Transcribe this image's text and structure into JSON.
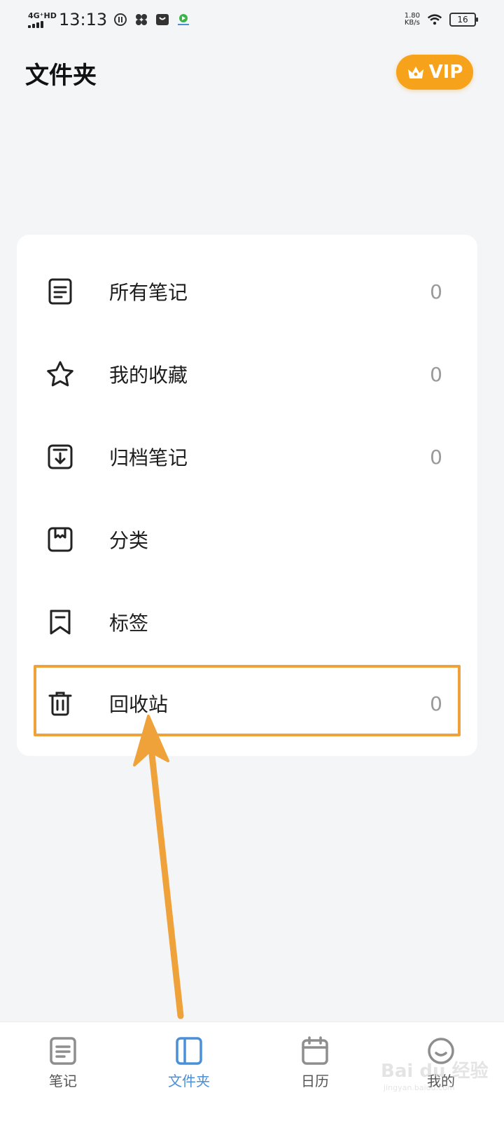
{
  "status_bar": {
    "network": "4G⁺HD",
    "time": "13:13",
    "speed_value": "1.80",
    "speed_unit": "KB/s",
    "battery": "16"
  },
  "header": {
    "title": "文件夹",
    "vip_label": "VIP"
  },
  "folders": [
    {
      "label": "所有笔记",
      "count": "0",
      "icon": "note-icon"
    },
    {
      "label": "我的收藏",
      "count": "0",
      "icon": "star-icon"
    },
    {
      "label": "归档笔记",
      "count": "0",
      "icon": "archive-icon"
    },
    {
      "label": "分类",
      "count": "",
      "icon": "category-icon"
    },
    {
      "label": "标签",
      "count": "",
      "icon": "bookmark-icon"
    },
    {
      "label": "回收站",
      "count": "0",
      "icon": "trash-icon"
    }
  ],
  "bottom_nav": [
    {
      "label": "笔记",
      "icon": "note-icon",
      "active": false
    },
    {
      "label": "文件夹",
      "icon": "folder-icon",
      "active": true
    },
    {
      "label": "日历",
      "icon": "calendar-icon",
      "active": false
    },
    {
      "label": "我的",
      "icon": "profile-icon",
      "active": false
    }
  ],
  "watermark": {
    "brand": "Bai du 经验",
    "url": "jingyan.baidu.com"
  },
  "colors": {
    "accent": "#f7a21b",
    "active_nav": "#4a90d9",
    "annotation": "#f0a23a"
  }
}
